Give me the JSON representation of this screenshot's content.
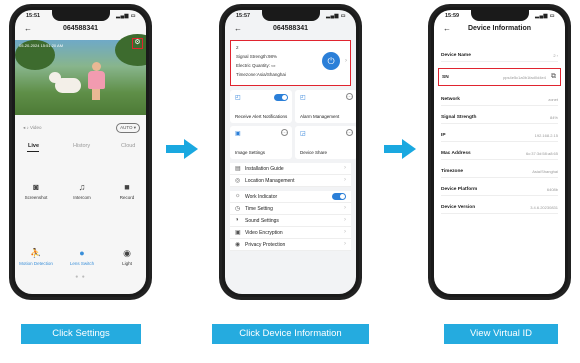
{
  "colors": {
    "accent": "#1aa8e0",
    "highlight": "#e0242f",
    "brand_blue": "#2b7fd8"
  },
  "phone1": {
    "time": "15:51",
    "title": "064588341",
    "stamp": "05-20-2024 15:51:20 AM",
    "volume_label": "Video",
    "quality_label": "AUTO",
    "tabs": [
      "Live",
      "History",
      "Cloud"
    ],
    "actions": [
      {
        "label": "Screenshot",
        "icon": "camera-icon"
      },
      {
        "label": "Intercom",
        "icon": "microphone-icon"
      },
      {
        "label": "Record",
        "icon": "video-record-icon"
      },
      {
        "label": "Motion Detection",
        "icon": "motion-icon"
      },
      {
        "label": "Lens Switch",
        "icon": "lens-icon"
      },
      {
        "label": "Light",
        "icon": "light-icon"
      }
    ]
  },
  "phone2": {
    "time": "15:57",
    "title": "064588341",
    "info": {
      "name": "2",
      "signal": "Signal Strength:98%",
      "battery": "Electric Quantity:",
      "timezone": "Timezone:Asia/Shanghai"
    },
    "tiles": [
      "Receive Alert Notifications",
      "Alarm Management",
      "Image Settings",
      "Device Share"
    ],
    "menu_a": [
      "Installation Guide",
      "Location Management"
    ],
    "menu_b": [
      "Work Indicator",
      "Time Setting",
      "Sound Settings",
      "Video Encryption",
      "Privacy Protection"
    ]
  },
  "phone3": {
    "time": "15:59",
    "title": "Device Information",
    "rows": [
      {
        "k": "Device Name",
        "v": "2"
      },
      {
        "k": "Network",
        "v": "zonet"
      },
      {
        "k": "Signal Strength",
        "v": "84%"
      },
      {
        "k": "IP",
        "v": "192.168.2.15"
      },
      {
        "k": "Mac Address",
        "v": "6c:37:3d:58:a8:65"
      },
      {
        "k": "Timezone",
        "v": "Asia/Shanghai"
      },
      {
        "k": "Device Platform",
        "v": "6408b"
      },
      {
        "k": "Device Version",
        "v": "3.4.6.20230831"
      }
    ],
    "sn": {
      "k": "SN",
      "v": "pps4e5c1a0b1fad0d4e4"
    }
  },
  "steps": [
    "Click Settings",
    "Click Device Information",
    "View Virtual ID"
  ]
}
